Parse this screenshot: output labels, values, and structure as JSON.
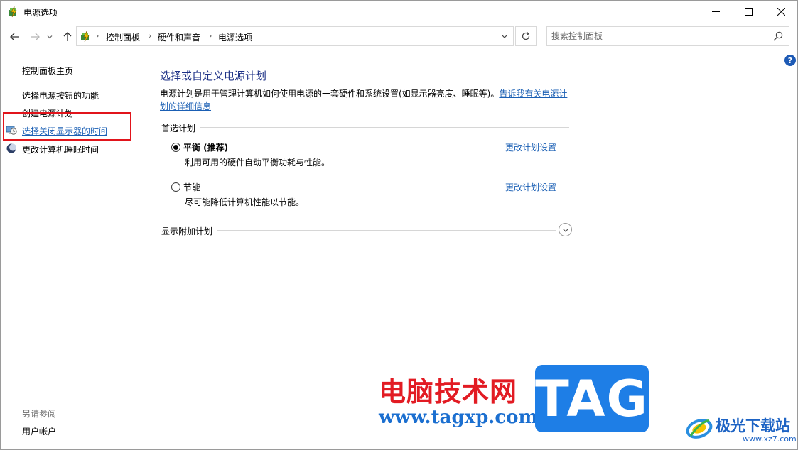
{
  "window": {
    "title": "电源选项"
  },
  "address": {
    "breadcrumbs": [
      "控制面板",
      "硬件和声音",
      "电源选项"
    ],
    "search_placeholder": "搜索控制面板"
  },
  "sidebar": {
    "home": "控制面板主页",
    "links": [
      {
        "label": "选择电源按钮的功能"
      },
      {
        "label": "创建电源计划"
      },
      {
        "label": "选择关闭显示器的时间"
      },
      {
        "label": "更改计算机睡眠时间"
      }
    ],
    "see_also_title": "另请参阅",
    "see_also_links": [
      {
        "label": "用户帐户"
      }
    ]
  },
  "main": {
    "title": "选择或自定义电源计划",
    "description": "电源计划是用于管理计算机如何使用电源的一套硬件和系统设置(如显示器亮度、睡眠等)。",
    "description_link": "告诉我有关电源计划的详细信息",
    "preferred_section": "首选计划",
    "plans": [
      {
        "name": "平衡 (推荐)",
        "desc": "利用可用的硬件自动平衡功耗与性能。",
        "link": "更改计划设置",
        "selected": true
      },
      {
        "name": "节能",
        "desc": "尽可能降低计算机性能以节能。",
        "link": "更改计划设置",
        "selected": false
      }
    ],
    "additional_section": "显示附加计划"
  },
  "help_label": "?",
  "watermark": {
    "cn_text": "电脑技术网",
    "url": "www.tagxp.com",
    "tag": "TAG",
    "site_name": "极光下载站",
    "site_url": "www.xz7.com"
  },
  "colors": {
    "link": "#1a5fb4",
    "title": "#1e3287",
    "highlight": "#e1141b",
    "watermark_red": "#e21b23",
    "watermark_blue": "#1e7ee6"
  }
}
